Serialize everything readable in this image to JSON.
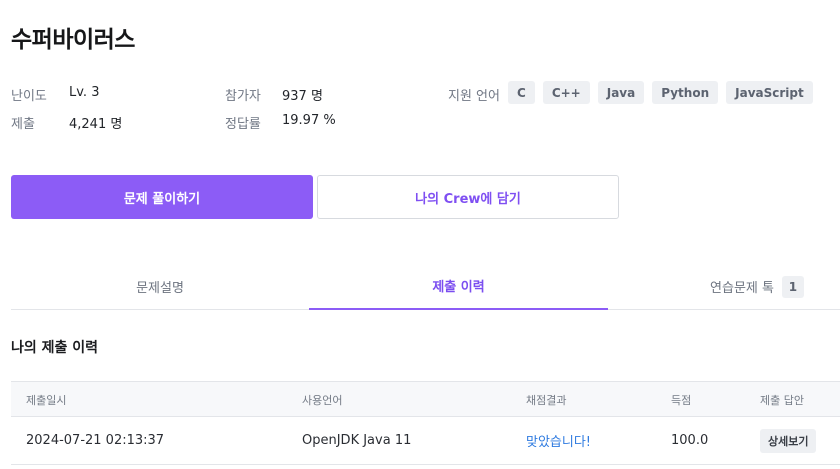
{
  "problem": {
    "title": "수퍼바이러스"
  },
  "meta": {
    "difficulty_label": "난이도",
    "difficulty_value": "Lv. 3",
    "submit_label": "제출",
    "submit_value": "4,241 명",
    "participants_label": "참가자",
    "participants_value": "937 명",
    "accuracy_label": "정답률",
    "accuracy_value": "19.97 %",
    "languages_label": "지원 언어",
    "languages": [
      "C",
      "C++",
      "Java",
      "Python",
      "JavaScript"
    ]
  },
  "actions": {
    "solve_label": "문제 풀이하기",
    "crew_label": "나의 Crew에 담기"
  },
  "tabs": [
    {
      "label": "문제설명",
      "active": false
    },
    {
      "label": "제출 이력",
      "active": true
    },
    {
      "label": "연습문제 톡",
      "active": false,
      "count": "1"
    }
  ],
  "history": {
    "title": "나의 제출 이력",
    "columns": [
      "제출일시",
      "사용언어",
      "채점결과",
      "득점",
      "제출 답안"
    ],
    "rows": [
      {
        "date": "2024-07-21 02:13:37",
        "language": "OpenJDK Java 11",
        "result": "맞았습니다!",
        "score": "100.0",
        "answer_label": "상세보기"
      }
    ]
  },
  "colors": {
    "accent": "#8c5cf6",
    "success": "#2f7be0"
  }
}
